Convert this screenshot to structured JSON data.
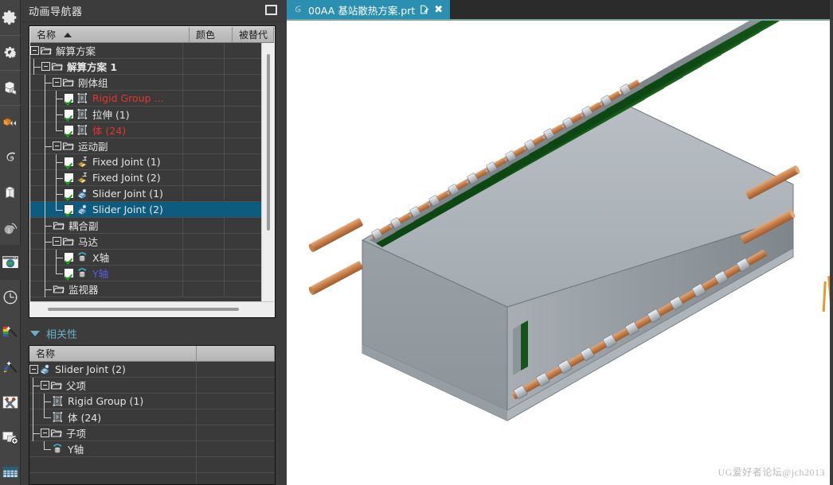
{
  "window": {
    "navigator_title": "动画导航器",
    "maximize_label": "最大化"
  },
  "rail": {
    "items": [
      {
        "name": "gear-icon",
        "label": "装配导航器"
      },
      {
        "name": "double-gear-icon",
        "label": "约束导航器"
      },
      {
        "name": "blocks-icon",
        "label": "部件导航器"
      },
      {
        "name": "cube-arrows-icon",
        "label": "重用库"
      },
      {
        "name": "snake-icon",
        "label": "HD3D 工具"
      },
      {
        "name": "books-icon",
        "label": "Web 浏览器"
      },
      {
        "name": "info-icon",
        "label": "历史记录"
      },
      {
        "name": "globe-window-icon",
        "label": "动画导航器"
      },
      {
        "name": "clock-icon",
        "label": "进程工作室"
      },
      {
        "name": "palette-wand-icon",
        "label": "角色"
      },
      {
        "name": "brush-wand-icon",
        "label": "系统场景"
      },
      {
        "name": "tools-icon",
        "label": "自定义"
      },
      {
        "name": "new-window-icon",
        "label": "新建窗口"
      },
      {
        "name": "grid-icon",
        "label": "表格"
      }
    ]
  },
  "tree": {
    "columns": [
      {
        "key": "name",
        "label": "名称",
        "sorted": true
      },
      {
        "key": "color",
        "label": "颜色",
        "sorted": false
      },
      {
        "key": "overridden",
        "label": "被替代",
        "sorted": false
      }
    ],
    "rows": [
      {
        "label": "解算方案",
        "depth": 0,
        "type": "folder",
        "expander": true,
        "check": false,
        "color": "normal",
        "bold": false,
        "selected": false
      },
      {
        "label": "解算方案 1",
        "depth": 1,
        "type": "folder",
        "expander": true,
        "check": false,
        "color": "normal",
        "bold": true,
        "selected": false
      },
      {
        "label": "刚体组",
        "depth": 2,
        "type": "folder",
        "expander": true,
        "check": false,
        "color": "normal",
        "bold": false,
        "selected": false
      },
      {
        "label": "Rigid Group ...",
        "depth": 3,
        "type": "body",
        "expander": false,
        "check": true,
        "color": "red",
        "bold": false,
        "selected": false
      },
      {
        "label": "拉伸 (1)",
        "depth": 3,
        "type": "body",
        "expander": false,
        "check": true,
        "color": "normal",
        "bold": false,
        "selected": false
      },
      {
        "label": "体 (24)",
        "depth": 3,
        "type": "body",
        "expander": false,
        "check": true,
        "color": "red",
        "bold": false,
        "selected": false,
        "last": true
      },
      {
        "label": "运动副",
        "depth": 2,
        "type": "folder",
        "expander": true,
        "check": false,
        "color": "normal",
        "bold": false,
        "selected": false
      },
      {
        "label": "Fixed Joint (1)",
        "depth": 3,
        "type": "fixed",
        "expander": false,
        "check": true,
        "color": "normal",
        "bold": false,
        "selected": false
      },
      {
        "label": "Fixed Joint (2)",
        "depth": 3,
        "type": "fixed",
        "expander": false,
        "check": true,
        "color": "normal",
        "bold": false,
        "selected": false
      },
      {
        "label": "Slider Joint (1)",
        "depth": 3,
        "type": "slider",
        "expander": false,
        "check": true,
        "color": "normal",
        "bold": false,
        "selected": false
      },
      {
        "label": "Slider Joint (2)",
        "depth": 3,
        "type": "slider",
        "expander": false,
        "check": true,
        "color": "normal",
        "bold": false,
        "selected": true,
        "last": true
      },
      {
        "label": "耦合副",
        "depth": 2,
        "type": "folder",
        "expander": false,
        "check": false,
        "color": "normal",
        "bold": false,
        "selected": false
      },
      {
        "label": "马达",
        "depth": 2,
        "type": "folder",
        "expander": true,
        "check": false,
        "color": "normal",
        "bold": false,
        "selected": false
      },
      {
        "label": "X轴",
        "depth": 3,
        "type": "motor",
        "expander": false,
        "check": true,
        "color": "normal",
        "bold": false,
        "selected": false
      },
      {
        "label": "Y轴",
        "depth": 3,
        "type": "motor",
        "expander": false,
        "check": true,
        "color": "blue",
        "bold": false,
        "selected": false,
        "last": true
      },
      {
        "label": "监视器",
        "depth": 2,
        "type": "folder",
        "expander": false,
        "check": false,
        "color": "normal",
        "bold": false,
        "selected": false
      }
    ]
  },
  "dependencies": {
    "section_title": "相关性",
    "collapsed": false,
    "columns": [
      {
        "key": "name",
        "label": "名称"
      },
      {
        "key": "blank",
        "label": ""
      }
    ],
    "rows": [
      {
        "label": "Slider Joint (2)",
        "depth": 0,
        "type": "slider",
        "expander": true
      },
      {
        "label": "父项",
        "depth": 1,
        "type": "folder",
        "expander": true
      },
      {
        "label": "Rigid Group (1)",
        "depth": 2,
        "type": "body",
        "expander": false
      },
      {
        "label": "体 (24)",
        "depth": 2,
        "type": "body",
        "expander": false,
        "last": true
      },
      {
        "label": "子项",
        "depth": 1,
        "type": "folder",
        "expander": true
      },
      {
        "label": "Y轴",
        "depth": 2,
        "type": "motor",
        "expander": false,
        "last": true
      },
      {
        "label": "",
        "depth": 0,
        "type": "empty",
        "expander": false
      },
      {
        "label": "",
        "depth": 0,
        "type": "empty",
        "expander": false
      }
    ]
  },
  "tabs": {
    "active_index": 0,
    "items": [
      {
        "title": "00AA 基站散热方案.prt",
        "modified_icon": "modified-doc-icon",
        "close_icon": "close-icon",
        "app_icon": "nx-part-icon"
      }
    ]
  },
  "viewport": {
    "watermark": "UG爱好者论坛@jch2013",
    "model_description": "基站散热器装配体 — 散热片阵列与铜管"
  },
  "colors": {
    "accent_tab": "#2a8fb0",
    "selection": "#0d5c80",
    "panel_bg": "#3c3c3c",
    "tree_bg": "#3a3a3a",
    "header_grey": "#bdbdbd",
    "text": "#e4e4e4",
    "red_label": "#e8342b",
    "blue_label": "#5a5ae0",
    "section_title": "#6ab0cc",
    "viewport_bg": "#ffffff"
  }
}
